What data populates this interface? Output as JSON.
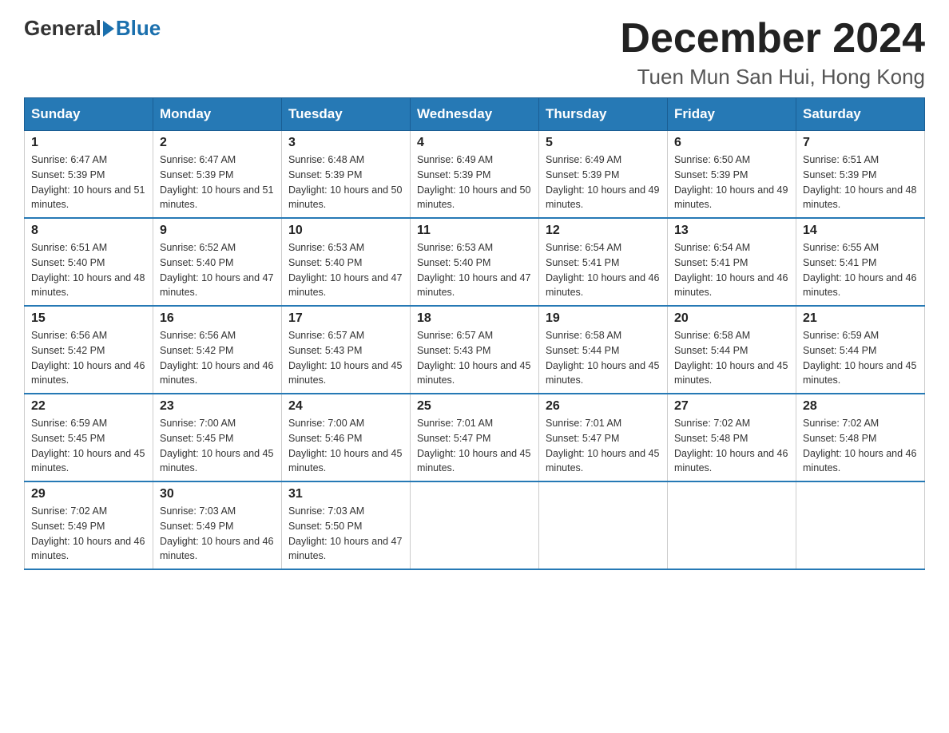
{
  "header": {
    "logo_general": "General",
    "logo_blue": "Blue",
    "month_title": "December 2024",
    "location": "Tuen Mun San Hui, Hong Kong"
  },
  "days_of_week": [
    "Sunday",
    "Monday",
    "Tuesday",
    "Wednesday",
    "Thursday",
    "Friday",
    "Saturday"
  ],
  "weeks": [
    [
      {
        "day": "1",
        "sunrise": "6:47 AM",
        "sunset": "5:39 PM",
        "daylight": "10 hours and 51 minutes."
      },
      {
        "day": "2",
        "sunrise": "6:47 AM",
        "sunset": "5:39 PM",
        "daylight": "10 hours and 51 minutes."
      },
      {
        "day": "3",
        "sunrise": "6:48 AM",
        "sunset": "5:39 PM",
        "daylight": "10 hours and 50 minutes."
      },
      {
        "day": "4",
        "sunrise": "6:49 AM",
        "sunset": "5:39 PM",
        "daylight": "10 hours and 50 minutes."
      },
      {
        "day": "5",
        "sunrise": "6:49 AM",
        "sunset": "5:39 PM",
        "daylight": "10 hours and 49 minutes."
      },
      {
        "day": "6",
        "sunrise": "6:50 AM",
        "sunset": "5:39 PM",
        "daylight": "10 hours and 49 minutes."
      },
      {
        "day": "7",
        "sunrise": "6:51 AM",
        "sunset": "5:39 PM",
        "daylight": "10 hours and 48 minutes."
      }
    ],
    [
      {
        "day": "8",
        "sunrise": "6:51 AM",
        "sunset": "5:40 PM",
        "daylight": "10 hours and 48 minutes."
      },
      {
        "day": "9",
        "sunrise": "6:52 AM",
        "sunset": "5:40 PM",
        "daylight": "10 hours and 47 minutes."
      },
      {
        "day": "10",
        "sunrise": "6:53 AM",
        "sunset": "5:40 PM",
        "daylight": "10 hours and 47 minutes."
      },
      {
        "day": "11",
        "sunrise": "6:53 AM",
        "sunset": "5:40 PM",
        "daylight": "10 hours and 47 minutes."
      },
      {
        "day": "12",
        "sunrise": "6:54 AM",
        "sunset": "5:41 PM",
        "daylight": "10 hours and 46 minutes."
      },
      {
        "day": "13",
        "sunrise": "6:54 AM",
        "sunset": "5:41 PM",
        "daylight": "10 hours and 46 minutes."
      },
      {
        "day": "14",
        "sunrise": "6:55 AM",
        "sunset": "5:41 PM",
        "daylight": "10 hours and 46 minutes."
      }
    ],
    [
      {
        "day": "15",
        "sunrise": "6:56 AM",
        "sunset": "5:42 PM",
        "daylight": "10 hours and 46 minutes."
      },
      {
        "day": "16",
        "sunrise": "6:56 AM",
        "sunset": "5:42 PM",
        "daylight": "10 hours and 46 minutes."
      },
      {
        "day": "17",
        "sunrise": "6:57 AM",
        "sunset": "5:43 PM",
        "daylight": "10 hours and 45 minutes."
      },
      {
        "day": "18",
        "sunrise": "6:57 AM",
        "sunset": "5:43 PM",
        "daylight": "10 hours and 45 minutes."
      },
      {
        "day": "19",
        "sunrise": "6:58 AM",
        "sunset": "5:44 PM",
        "daylight": "10 hours and 45 minutes."
      },
      {
        "day": "20",
        "sunrise": "6:58 AM",
        "sunset": "5:44 PM",
        "daylight": "10 hours and 45 minutes."
      },
      {
        "day": "21",
        "sunrise": "6:59 AM",
        "sunset": "5:44 PM",
        "daylight": "10 hours and 45 minutes."
      }
    ],
    [
      {
        "day": "22",
        "sunrise": "6:59 AM",
        "sunset": "5:45 PM",
        "daylight": "10 hours and 45 minutes."
      },
      {
        "day": "23",
        "sunrise": "7:00 AM",
        "sunset": "5:45 PM",
        "daylight": "10 hours and 45 minutes."
      },
      {
        "day": "24",
        "sunrise": "7:00 AM",
        "sunset": "5:46 PM",
        "daylight": "10 hours and 45 minutes."
      },
      {
        "day": "25",
        "sunrise": "7:01 AM",
        "sunset": "5:47 PM",
        "daylight": "10 hours and 45 minutes."
      },
      {
        "day": "26",
        "sunrise": "7:01 AM",
        "sunset": "5:47 PM",
        "daylight": "10 hours and 45 minutes."
      },
      {
        "day": "27",
        "sunrise": "7:02 AM",
        "sunset": "5:48 PM",
        "daylight": "10 hours and 46 minutes."
      },
      {
        "day": "28",
        "sunrise": "7:02 AM",
        "sunset": "5:48 PM",
        "daylight": "10 hours and 46 minutes."
      }
    ],
    [
      {
        "day": "29",
        "sunrise": "7:02 AM",
        "sunset": "5:49 PM",
        "daylight": "10 hours and 46 minutes."
      },
      {
        "day": "30",
        "sunrise": "7:03 AM",
        "sunset": "5:49 PM",
        "daylight": "10 hours and 46 minutes."
      },
      {
        "day": "31",
        "sunrise": "7:03 AM",
        "sunset": "5:50 PM",
        "daylight": "10 hours and 47 minutes."
      },
      null,
      null,
      null,
      null
    ]
  ]
}
